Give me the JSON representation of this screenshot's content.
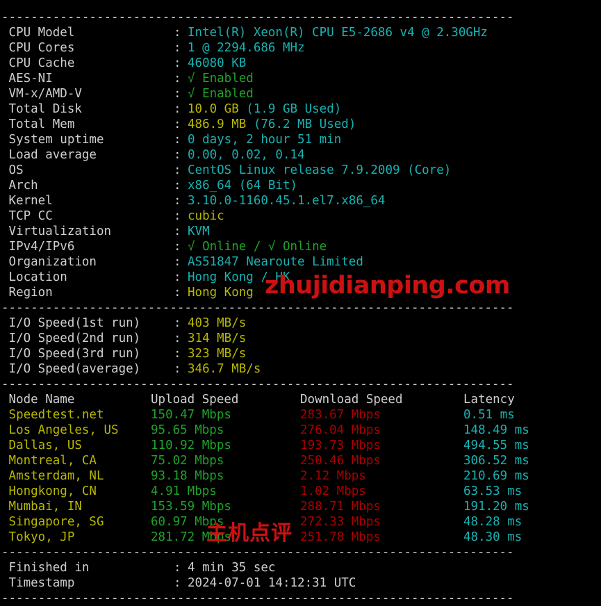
{
  "terminal": {
    "separator": "----------------------------------------------------------------------",
    "colon": ":"
  },
  "watermarks": {
    "site": "zhujidianping.com",
    "cn": "主机点评"
  },
  "system_info": {
    "rows": [
      {
        "label": "CPU Model",
        "value": "Intel(R) Xeon(R) CPU E5-2686 v4 @ 2.30GHz",
        "color": "cyan"
      },
      {
        "label": "CPU Cores",
        "value": "1 @ 2294.686 MHz",
        "color": "cyan"
      },
      {
        "label": "CPU Cache",
        "value": "46080 KB",
        "color": "cyan"
      },
      {
        "label": "AES-NI",
        "value": "√ Enabled",
        "color": "green"
      },
      {
        "label": "VM-x/AMD-V",
        "value": "√ Enabled",
        "color": "green"
      },
      {
        "label": "Total Disk",
        "value": "10.0 GB",
        "extra": "(1.9 GB Used)",
        "color": "yellow",
        "extra_color": "cyan"
      },
      {
        "label": "Total Mem",
        "value": "486.9 MB",
        "extra": "(76.2 MB Used)",
        "color": "yellow",
        "extra_color": "cyan"
      },
      {
        "label": "System uptime",
        "value": "0 days, 2 hour 51 min",
        "color": "cyan"
      },
      {
        "label": "Load average",
        "value": "0.00, 0.02, 0.14",
        "color": "cyan"
      },
      {
        "label": "OS",
        "value": "CentOS Linux release 7.9.2009 (Core)",
        "color": "cyan"
      },
      {
        "label": "Arch",
        "value": "x86_64 (64 Bit)",
        "color": "cyan"
      },
      {
        "label": "Kernel",
        "value": "3.10.0-1160.45.1.el7.x86_64",
        "color": "cyan"
      },
      {
        "label": "TCP CC",
        "value": "cubic",
        "color": "yellow"
      },
      {
        "label": "Virtualization",
        "value": "KVM",
        "color": "cyan"
      },
      {
        "label": "IPv4/IPv6",
        "value": "√ Online / √ Online",
        "color": "green"
      },
      {
        "label": "Organization",
        "value": "AS51847 Nearoute Limited",
        "color": "cyan"
      },
      {
        "label": "Location",
        "value": "Hong Kong / HK",
        "color": "cyan"
      },
      {
        "label": "Region",
        "value": "Hong Kong",
        "color": "yellow"
      }
    ]
  },
  "io_speed": {
    "rows": [
      {
        "label": "I/O Speed(1st run)",
        "value": "403 MB/s"
      },
      {
        "label": "I/O Speed(2nd run)",
        "value": "314 MB/s"
      },
      {
        "label": "I/O Speed(3rd run)",
        "value": "323 MB/s"
      },
      {
        "label": "I/O Speed(average)",
        "value": "346.7 MB/s"
      }
    ]
  },
  "speedtest": {
    "headers": {
      "node": "Node Name",
      "upload": "Upload Speed",
      "download": "Download Speed",
      "latency": "Latency"
    },
    "rows": [
      {
        "node": "Speedtest.net",
        "upload": "150.47 Mbps",
        "download": "283.67 Mbps",
        "latency": "0.51 ms"
      },
      {
        "node": "Los Angeles, US",
        "upload": "95.65 Mbps",
        "download": "276.04 Mbps",
        "latency": "148.49 ms"
      },
      {
        "node": "Dallas, US",
        "upload": "110.92 Mbps",
        "download": "193.73 Mbps",
        "latency": "494.55 ms"
      },
      {
        "node": "Montreal, CA",
        "upload": "75.02 Mbps",
        "download": "250.46 Mbps",
        "latency": "306.52 ms"
      },
      {
        "node": "Amsterdam, NL",
        "upload": "93.18 Mbps",
        "download": "2.12 Mbps",
        "latency": "210.69 ms"
      },
      {
        "node": "Hongkong, CN",
        "upload": "4.91 Mbps",
        "download": "1.02 Mbps",
        "latency": "63.53 ms"
      },
      {
        "node": "Mumbai, IN",
        "upload": "153.59 Mbps",
        "download": "288.71 Mbps",
        "latency": "191.20 ms"
      },
      {
        "node": "Singapore, SG",
        "upload": "60.97 Mbps",
        "download": "272.33 Mbps",
        "latency": "48.28 ms"
      },
      {
        "node": "Tokyo, JP",
        "upload": "281.72 Mbps",
        "download": "251.78 Mbps",
        "latency": "48.30 ms"
      }
    ]
  },
  "footer": {
    "rows": [
      {
        "label": "Finished in",
        "value": "4 min 35 sec"
      },
      {
        "label": "Timestamp",
        "value": "2024-07-01 14:12:31 UTC"
      }
    ]
  }
}
